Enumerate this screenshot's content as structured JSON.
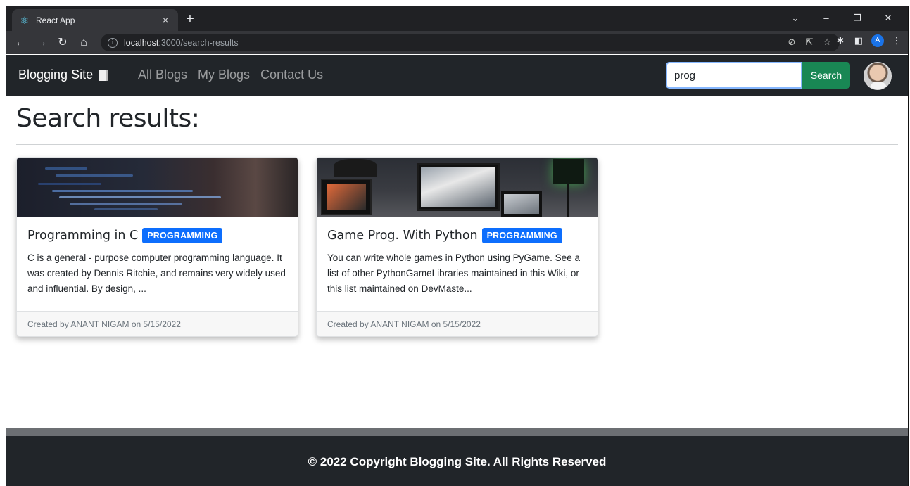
{
  "browser": {
    "tab_title": "React App",
    "tab_close": "×",
    "new_tab": "+",
    "url_host": "localhost",
    "url_rest": ":3000/search-results",
    "window_controls": [
      "⌄",
      "–",
      "❐",
      "✕"
    ]
  },
  "navbar": {
    "brand": "Blogging Site",
    "links": [
      "All Blogs",
      "My Blogs",
      "Contact Us"
    ],
    "search_value": "prog",
    "search_button": "Search"
  },
  "main": {
    "heading": "Search results:",
    "cards": [
      {
        "title": "Programming in C",
        "badge": "PROGRAMMING",
        "text": "C is a general - purpose computer programming language. It was created by Dennis Ritchie, and remains very widely used and influential. By design, ...",
        "footer": "Created by ANANT NIGAM on 5/15/2022"
      },
      {
        "title": "Game Prog. With Python",
        "badge": "PROGRAMMING",
        "text": "You can write whole games in Python using PyGame. See a list of other PythonGameLibraries maintained in this Wiki, or this list maintained on DevMaste...",
        "footer": "Created by ANANT NIGAM on 5/15/2022"
      }
    ]
  },
  "footer": {
    "text": "© 2022 Copyright Blogging Site. All Rights Reserved"
  },
  "colors": {
    "navbar_bg": "#212529",
    "badge_bg": "#0d6efd",
    "search_button_bg": "#198754",
    "footer_bg": "#212529"
  }
}
